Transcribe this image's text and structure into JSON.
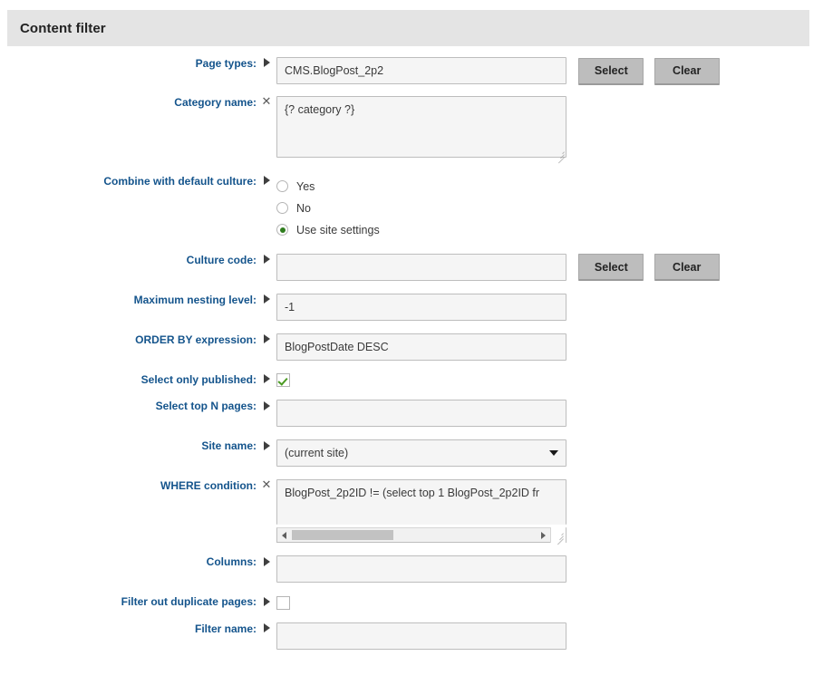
{
  "panel": {
    "title": "Content filter",
    "header_bg": "#e4e4e4",
    "label_color": "#14548c"
  },
  "buttons": {
    "select_label": "Select",
    "clear_label": "Clear"
  },
  "fields": {
    "page_types": {
      "label": "Page types:",
      "marker": "arrow",
      "value": "CMS.BlogPost_2p2"
    },
    "category_name": {
      "label": "Category name:",
      "marker": "cross",
      "value": "{? category ?}"
    },
    "combine_with_default_culture": {
      "label": "Combine with default culture:",
      "marker": "arrow",
      "options": [
        "Yes",
        "No",
        "Use site settings"
      ],
      "selected": "Use site settings"
    },
    "culture_code": {
      "label": "Culture code:",
      "marker": "arrow",
      "value": ""
    },
    "maximum_nesting_level": {
      "label": "Maximum nesting level:",
      "marker": "arrow",
      "value": "-1"
    },
    "order_by_expression": {
      "label": "ORDER BY expression:",
      "marker": "arrow",
      "value": "BlogPostDate DESC"
    },
    "select_only_published": {
      "label": "Select only published:",
      "marker": "arrow",
      "checked": true
    },
    "select_top_n_pages": {
      "label": "Select top N pages:",
      "marker": "arrow",
      "value": ""
    },
    "site_name": {
      "label": "Site name:",
      "marker": "arrow",
      "value": "(current site)"
    },
    "where_condition": {
      "label": "WHERE condition:",
      "marker": "cross",
      "value": "BlogPost_2p2ID != (select top 1 BlogPost_2p2ID fr"
    },
    "columns": {
      "label": "Columns:",
      "marker": "arrow",
      "value": ""
    },
    "filter_out_duplicate_pages": {
      "label": "Filter out duplicate pages:",
      "marker": "arrow",
      "checked": false
    },
    "filter_name": {
      "label": "Filter name:",
      "marker": "arrow",
      "value": ""
    }
  }
}
